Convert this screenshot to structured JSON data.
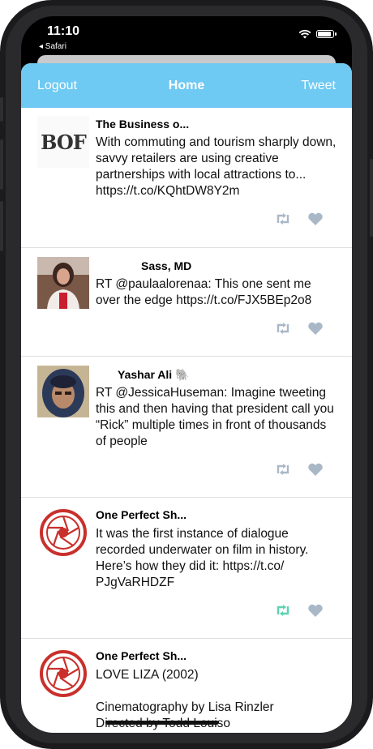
{
  "status": {
    "time": "11:10",
    "back_label": "◂ Safari"
  },
  "navbar": {
    "left": "Logout",
    "title": "Home",
    "right": "Tweet"
  },
  "colors": {
    "nav": "#6ec9f3",
    "action_gray": "#a9b8c7",
    "retweet_active": "#5cd3b0"
  },
  "tweets": [
    {
      "name": "The Business o...",
      "text": "With commuting and tourism sharply down, savvy retailers are using creative partnerships with local attractions to... https://t.co/KQhtDW8Y2m",
      "logo": "BOF",
      "retweeted": false
    },
    {
      "name": "Sass, MD",
      "text": "RT @paulaalorenaa: This one sent me over the edge https://t.co/FJX5BEp2o8",
      "retweeted": false
    },
    {
      "name": "Yashar Ali 🐘",
      "text": "RT @JessicaHuseman: Imagine tweeting this and then having that president call you “Rick” multiple times in front of thousands of people",
      "retweeted": false
    },
    {
      "name": "One Perfect Sh...",
      "text": "It was the first instance of dialogue recorded underwater on film in history. Here’s how they did it: https://t.co/ PJgVaRHDZF",
      "retweeted": true
    },
    {
      "name": "One Perfect Sh...",
      "text": "LOVE LIZA (2002)\n\nCinematography by Lisa Rinzler\nDirected by Todd Louiso",
      "retweeted": false
    }
  ]
}
